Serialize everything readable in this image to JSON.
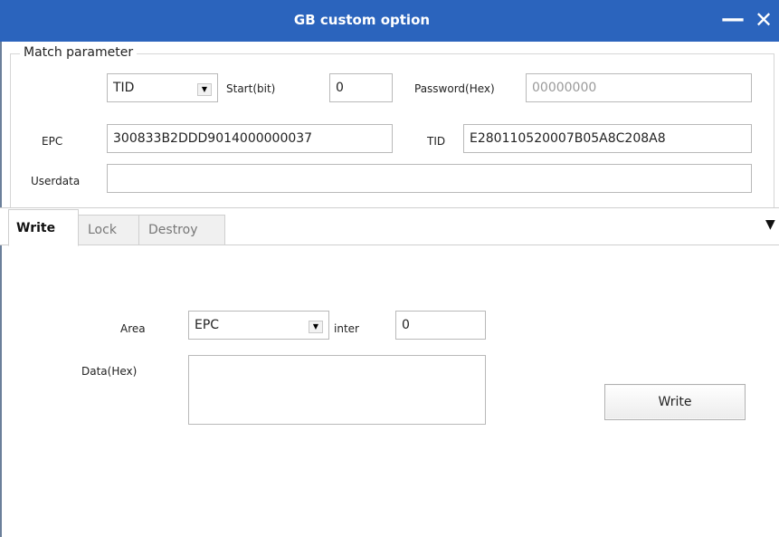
{
  "window": {
    "title": "GB custom option",
    "minimize_glyph": "—",
    "close_glyph": "✕"
  },
  "match": {
    "group_label": "Match parameter",
    "bank_value": "TID",
    "bank_arrow": "▼",
    "start_label": "Start(bit)",
    "start_value": "0",
    "password_label": "Password(Hex)",
    "password_placeholder": "00000000",
    "epc_label": "EPC",
    "epc_value": "300833B2DDD9014000000037",
    "tid_label": "TID",
    "tid_value": "E280110520007B05A8C208A8",
    "userdata_label": "Userdata",
    "userdata_value": ""
  },
  "tabs": {
    "items": [
      {
        "label": "Write",
        "active": true
      },
      {
        "label": "Lock",
        "active": false
      },
      {
        "label": "Destroy",
        "active": false
      }
    ],
    "menu_glyph": "▼"
  },
  "write": {
    "area_label": "Area",
    "area_value": "EPC",
    "area_arrow": "▼",
    "inter_label": "inter",
    "inter_value": "0",
    "data_label": "Data(Hex)",
    "data_value": "",
    "write_button": "Write"
  }
}
